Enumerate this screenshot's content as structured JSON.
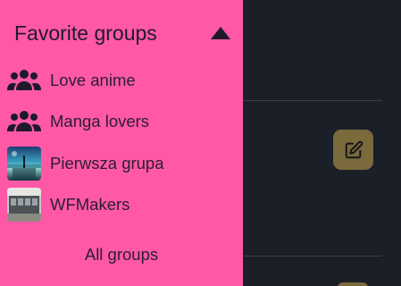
{
  "drawer": {
    "title": "Favorite groups",
    "collapse_icon": "triangle-up-icon",
    "groups": [
      {
        "label": "Love anime",
        "icon": "group-people-icon"
      },
      {
        "label": "Manga lovers",
        "icon": "group-people-icon"
      },
      {
        "label": "Pierwsza grupa",
        "icon": "group-thumbnail-image"
      },
      {
        "label": "WFMakers",
        "icon": "group-thumbnail-image"
      }
    ],
    "all_groups_label": "All groups"
  },
  "background": {
    "edit_icon": "edit-icon"
  },
  "colors": {
    "drawer_bg": "#ff58a7",
    "app_bg": "#1b1f27",
    "accent": "#7a6a3c"
  }
}
